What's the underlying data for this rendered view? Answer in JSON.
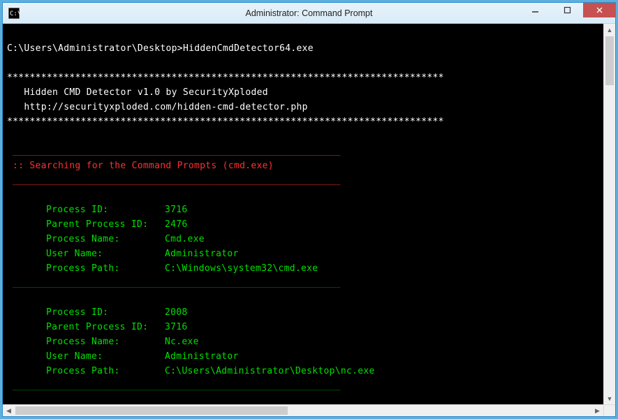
{
  "window": {
    "title": "Administrator: Command Prompt"
  },
  "prompt": {
    "path": "C:\\Users\\Administrator\\Desktop>",
    "command": "HiddenCmdDetector64.exe"
  },
  "header": {
    "star_line": "*****************************************************************************",
    "title": "Hidden CMD Detector v1.0 by SecurityXploded",
    "url": "http://securityxploded.com/hidden-cmd-detector.php"
  },
  "search": {
    "sep": "________________________________________________________________",
    "text": ":: Searching for the Command Prompts (cmd.exe)"
  },
  "proc_labels": {
    "pid": "Process ID:",
    "ppid": "Parent Process ID:",
    "name": "Process Name:",
    "user": "User Name:",
    "path": "Process Path:"
  },
  "proc_sep": "________________________________________________________________",
  "processes": [
    {
      "pid": "3716",
      "ppid": "2476",
      "name": "Cmd.exe",
      "user": "Administrator",
      "path": "C:\\Windows\\system32\\cmd.exe"
    },
    {
      "pid": "2008",
      "ppid": "3716",
      "name": "Nc.exe",
      "user": "Administrator",
      "path": "C:\\Users\\Administrator\\Desktop\\nc.exe"
    }
  ]
}
